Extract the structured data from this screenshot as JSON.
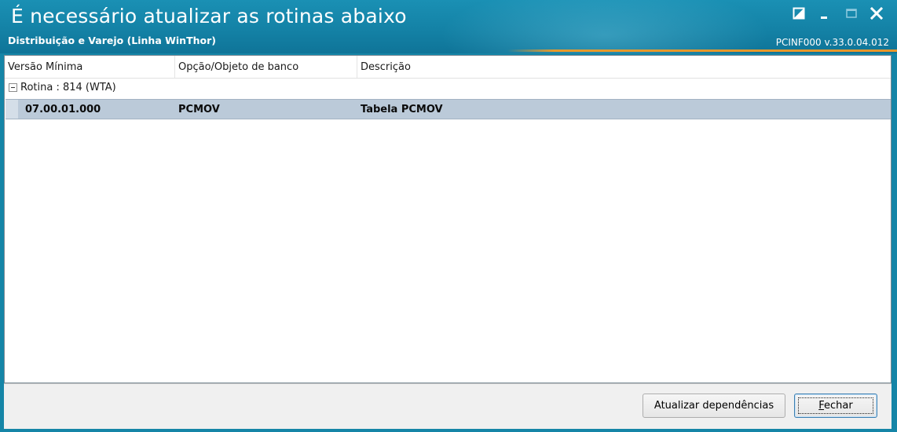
{
  "window": {
    "title": "É necessário atualizar as rotinas abaixo",
    "subtitle": "Distribuição e Varejo (Linha WinThor)",
    "version": "PCINF000  v.33.0.04.012",
    "colors": {
      "titlebar": "#1585a7",
      "accent_line": "#e8962a",
      "selected_row": "#bbcad9"
    },
    "controls": {
      "restore_icon": "restore-icon",
      "minimize_icon": "minimize-icon",
      "maximize_icon": "maximize-icon",
      "close_icon": "close-icon"
    }
  },
  "grid": {
    "columns": [
      "Versão Mínima",
      "Opção/Objeto de banco",
      "Descrição"
    ],
    "groups": [
      {
        "label": "Rotina : 814 (WTA)",
        "expanded": true,
        "rows": [
          [
            "07.00.01.000",
            "PCMOV",
            "Tabela PCMOV"
          ]
        ]
      }
    ]
  },
  "footer": {
    "update_button": "Atualizar dependências",
    "close_button": "Fechar"
  }
}
